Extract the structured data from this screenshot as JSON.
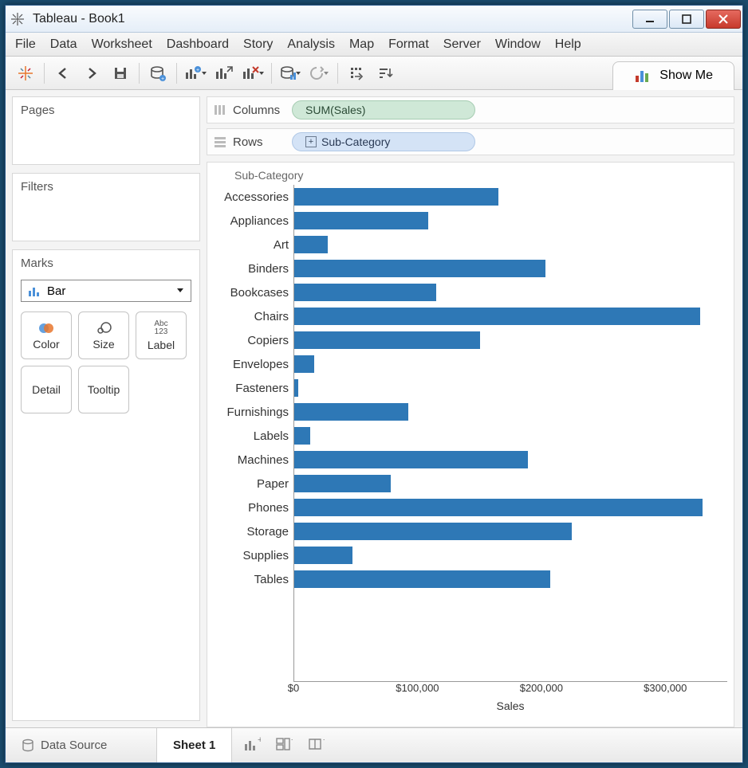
{
  "window": {
    "title": "Tableau - Book1"
  },
  "menu": [
    "File",
    "Data",
    "Worksheet",
    "Dashboard",
    "Story",
    "Analysis",
    "Map",
    "Format",
    "Server",
    "Window",
    "Help"
  ],
  "toolbar": {
    "showme_label": "Show Me"
  },
  "shelves": {
    "pages_title": "Pages",
    "filters_title": "Filters",
    "marks_title": "Marks",
    "columns_label": "Columns",
    "rows_label": "Rows",
    "columns_pill": "SUM(Sales)",
    "rows_pill": "Sub-Category"
  },
  "marks": {
    "type": "Bar",
    "buttons": {
      "color": "Color",
      "size": "Size",
      "label": "Label",
      "label_icon": "Abc\n123",
      "detail": "Detail",
      "tooltip": "Tooltip"
    }
  },
  "bottom": {
    "data_source": "Data Source",
    "sheet": "Sheet 1"
  },
  "chart_data": {
    "type": "bar",
    "orientation": "horizontal",
    "header": "Sub-Category",
    "categories": [
      "Accessories",
      "Appliances",
      "Art",
      "Binders",
      "Bookcases",
      "Chairs",
      "Copiers",
      "Envelopes",
      "Fasteners",
      "Furnishings",
      "Labels",
      "Machines",
      "Paper",
      "Phones",
      "Storage",
      "Supplies",
      "Tables"
    ],
    "values": [
      165000,
      108000,
      27000,
      203000,
      115000,
      328000,
      150000,
      16000,
      3000,
      92000,
      13000,
      189000,
      78000,
      330000,
      224000,
      47000,
      207000
    ],
    "xlabel": "Sales",
    "ylabel": "",
    "xlim": [
      0,
      350000
    ],
    "x_ticks": [
      0,
      100000,
      200000,
      300000
    ],
    "x_tick_labels": [
      "$0",
      "$100,000",
      "$200,000",
      "$300,000"
    ],
    "tick_prefix": "$",
    "color": "#2e78b6"
  }
}
